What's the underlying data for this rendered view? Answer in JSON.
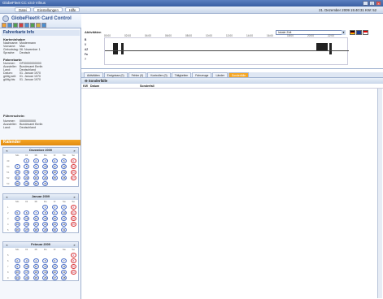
{
  "window": {
    "title": "GlobeFleet CC v3.0 Vilnus"
  },
  "menu": {
    "items": [
      "Datei",
      "Einstellungen",
      "Hilfe"
    ]
  },
  "header": {
    "datetime": "21. Dezember 2009  15:40:31   KW: 52"
  },
  "brand": {
    "name": "GlobeFleet® Card Control"
  },
  "fahrerkarte": {
    "title": "Fahrerkarte Info",
    "karteninhaber": {
      "title": "Karteninhaber",
      "rows": [
        [
          "Nachname:",
          "Mustermann"
        ],
        [
          "Vorname:",
          "Max"
        ],
        [
          "Geburtstag:",
          "06. November 1"
        ],
        [
          "Sprache:",
          "Deutsch"
        ]
      ]
    },
    "karte": {
      "title": "Fahrerkarte:",
      "rows": [
        [
          "Nummer:",
          "DF00000000000"
        ],
        [
          "Aussteller:",
          "Bundesamt Berlin"
        ],
        [
          "Land:",
          "Deutschland"
        ],
        [
          "Datum:",
          "01. Januar 1970"
        ],
        [
          "gültig seit:",
          "01. Januar 1970"
        ],
        [
          "gültig bis:",
          "01. Januar 1970"
        ]
      ]
    },
    "schein": {
      "title": "Führerschein:",
      "rows": [
        [
          "Nummer:",
          "0000000000"
        ],
        [
          "Aussteller:",
          "Bundesamt Berlin"
        ],
        [
          "Land:",
          "Deutschland"
        ]
      ]
    }
  },
  "kalender": {
    "title": "Kalender",
    "dow": [
      "",
      "Mo",
      "Di",
      "Mi",
      "Do",
      "Fr",
      "Sa",
      "So"
    ],
    "months": [
      {
        "name": "Dezember 2009",
        "weeks": [
          [
            "49",
            "",
            "1",
            "2",
            "3",
            "4",
            "5",
            "6"
          ],
          [
            "50",
            "7",
            "8",
            "9",
            "10",
            "11",
            "12",
            "13"
          ],
          [
            "51",
            "14",
            "15",
            "16",
            "17",
            "18",
            "19",
            "20"
          ],
          [
            "52",
            "21",
            "22",
            "23",
            "24",
            "25",
            "26",
            "27"
          ],
          [
            "53",
            "28",
            "29",
            "30",
            "31",
            "",
            "",
            ""
          ]
        ]
      },
      {
        "name": "Januar 2009",
        "weeks": [
          [
            "1",
            "",
            "",
            "",
            "1",
            "2",
            "3",
            "4"
          ],
          [
            "2",
            "5",
            "6",
            "7",
            "8",
            "9",
            "10",
            "11"
          ],
          [
            "3",
            "12",
            "13",
            "14",
            "15",
            "16",
            "17",
            "18"
          ],
          [
            "4",
            "19",
            "20",
            "21",
            "22",
            "23",
            "24",
            "25"
          ],
          [
            "5",
            "26",
            "27",
            "28",
            "29",
            "30",
            "31",
            ""
          ]
        ]
      },
      {
        "name": "Februar 2009",
        "weeks": [
          [
            "5",
            "",
            "",
            "",
            "",
            "",
            "",
            "1"
          ],
          [
            "6",
            "2",
            "3",
            "4",
            "5",
            "6",
            "7",
            "8"
          ],
          [
            "7",
            "9",
            "10",
            "11",
            "12",
            "13",
            "14",
            "15"
          ],
          [
            "8",
            "16",
            "17",
            "18",
            "19",
            "20",
            "21",
            "22"
          ],
          [
            "9",
            "23",
            "24",
            "25",
            "26",
            "27",
            "28",
            ""
          ]
        ]
      }
    ]
  },
  "chart": {
    "label": "Aktivitäten",
    "hours": [
      "00:00",
      "02:00",
      "04:00",
      "06:00",
      "08:00",
      "10:00",
      "12:00",
      "14:00",
      "16:00",
      "18:00",
      "20:00",
      "22:00"
    ],
    "activities": [
      "B",
      "V",
      "AZ",
      "Fa",
      "?"
    ]
  },
  "zeit": {
    "value": "lokale Zeit"
  },
  "tabs": [
    "Aktivitäten",
    "Ereignisse (0)",
    "Fehler (0)",
    "Kontrollen (0)",
    "Tätigkeiten",
    "Fahrzeuge",
    "Länder",
    "Sonderfälle"
  ],
  "subview": {
    "title": "Sonderfälle",
    "columns": [
      "KW",
      "Datum",
      "Sonderfall"
    ]
  }
}
